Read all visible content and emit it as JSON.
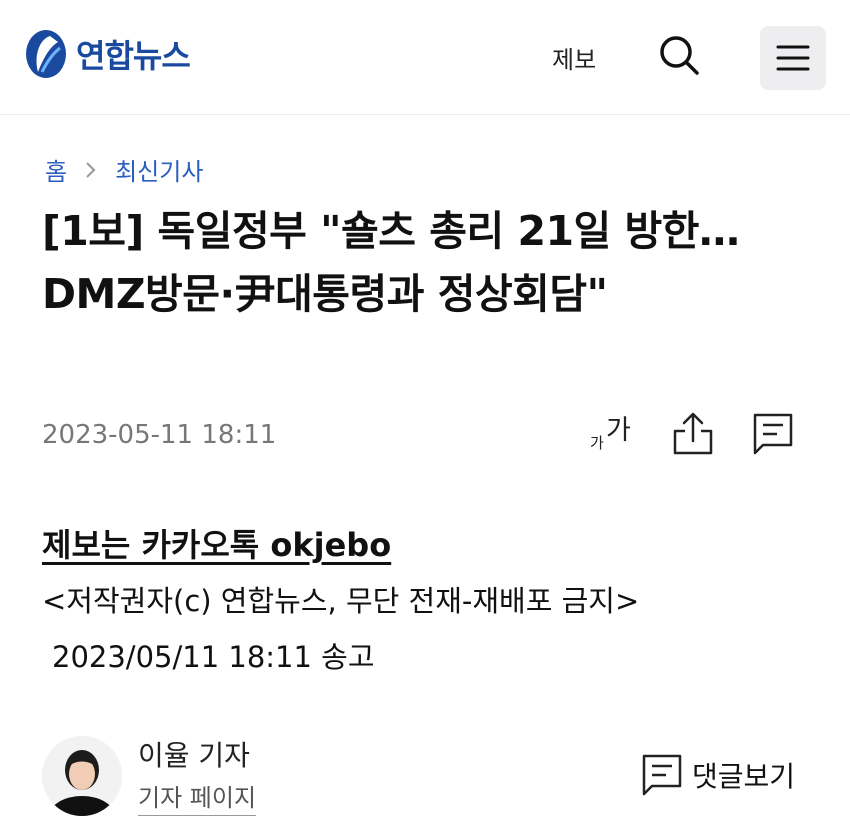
{
  "header": {
    "logo_text": "연합뉴스",
    "tip_link": "제보",
    "search_icon": "search-icon",
    "menu_icon": "hamburger-menu-icon"
  },
  "breadcrumb": {
    "home": "홈",
    "section": "최신기사"
  },
  "article": {
    "title": "[1보] 독일정부 \"숄츠 총리 21일 방한…DMZ방문·尹대통령과 정상회담\"",
    "datetime": "2023-05-11 18:11",
    "tools": {
      "fontsize_small": "가",
      "fontsize_large": "가"
    },
    "tip_line": "제보는 카카오톡 okjebo",
    "copyright": "<저작권자(c) 연합뉴스, 무단 전재-재배포 금지>",
    "send_time": "2023/05/11 18:11 송고"
  },
  "author": {
    "name": "이율 기자",
    "page_link": "기자 페이지"
  },
  "comments": {
    "label": "댓글보기"
  },
  "colors": {
    "brand": "#1a4aa0",
    "link": "#2a5fc0"
  }
}
